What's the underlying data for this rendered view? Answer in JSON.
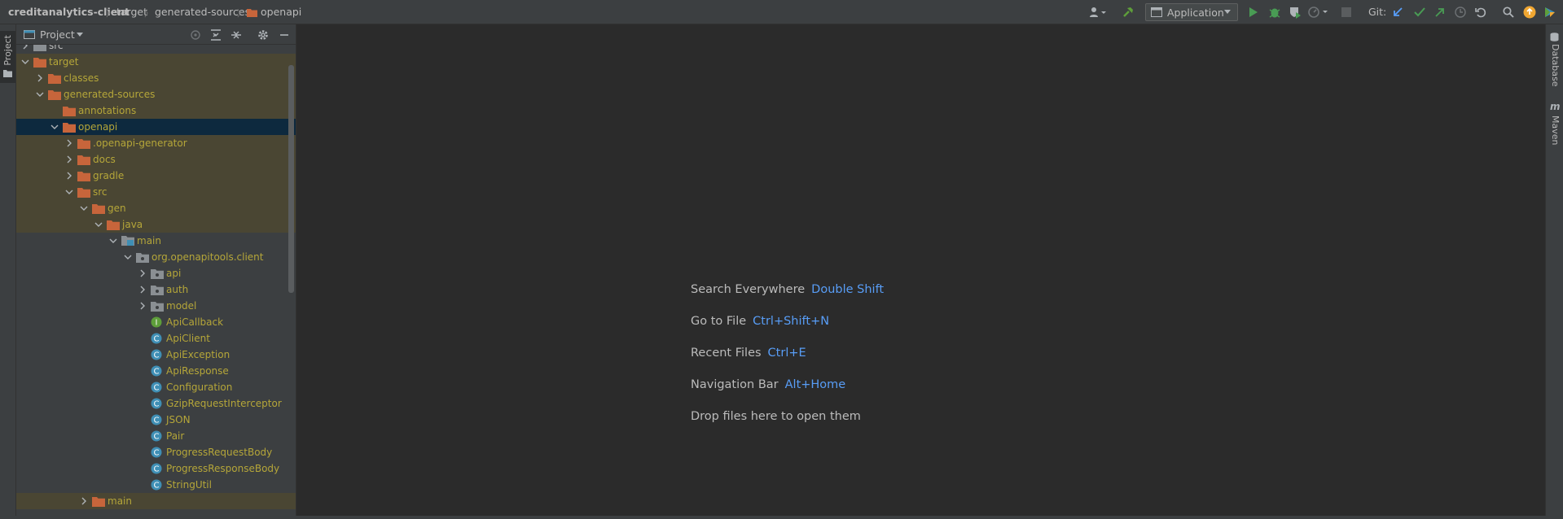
{
  "breadcrumb": [
    "creditanalytics-client",
    "target",
    "generated-sources",
    "openapi"
  ],
  "toolbar": {
    "run_config": "Application",
    "git_label": "Git:"
  },
  "left_strip": {
    "project_tab": "Project"
  },
  "right_strip": {
    "database_tab": "Database",
    "maven_tab": "Maven"
  },
  "project_panel": {
    "view_selector": "Project"
  },
  "tree": [
    {
      "label": "src",
      "depth": 1,
      "expanded": false,
      "type": "folder-gray",
      "style": "plain"
    },
    {
      "label": "target",
      "depth": 1,
      "expanded": true,
      "type": "folder-orange",
      "style": "excluded"
    },
    {
      "label": "classes",
      "depth": 2,
      "expanded": false,
      "type": "folder-orange",
      "style": "excluded"
    },
    {
      "label": "generated-sources",
      "depth": 2,
      "expanded": true,
      "type": "folder-orange",
      "style": "excluded"
    },
    {
      "label": "annotations",
      "depth": 3,
      "expanded": null,
      "type": "folder-orange",
      "style": "excluded"
    },
    {
      "label": "openapi",
      "depth": 3,
      "expanded": true,
      "type": "folder-orange",
      "style": "selected"
    },
    {
      "label": ".openapi-generator",
      "depth": 4,
      "expanded": false,
      "type": "folder-orange",
      "style": "excluded"
    },
    {
      "label": "docs",
      "depth": 4,
      "expanded": false,
      "type": "folder-orange",
      "style": "excluded"
    },
    {
      "label": "gradle",
      "depth": 4,
      "expanded": false,
      "type": "folder-orange",
      "style": "excluded"
    },
    {
      "label": "src",
      "depth": 4,
      "expanded": true,
      "type": "folder-orange",
      "style": "excluded"
    },
    {
      "label": "gen",
      "depth": 5,
      "expanded": true,
      "type": "folder-orange",
      "style": "excluded"
    },
    {
      "label": "java",
      "depth": 6,
      "expanded": true,
      "type": "folder-orange",
      "style": "excluded"
    },
    {
      "label": "main",
      "depth": 7,
      "expanded": true,
      "type": "folder-module",
      "style": "plainOlive"
    },
    {
      "label": "org.openapitools.client",
      "depth": 8,
      "expanded": true,
      "type": "package",
      "style": "plainOlive"
    },
    {
      "label": "api",
      "depth": 9,
      "expanded": false,
      "type": "package",
      "style": "plainOlive"
    },
    {
      "label": "auth",
      "depth": 9,
      "expanded": false,
      "type": "package",
      "style": "plainOlive"
    },
    {
      "label": "model",
      "depth": 9,
      "expanded": false,
      "type": "package",
      "style": "plainOlive"
    },
    {
      "label": "ApiCallback",
      "depth": 9,
      "expanded": null,
      "type": "interface",
      "style": "plainOlive"
    },
    {
      "label": "ApiClient",
      "depth": 9,
      "expanded": null,
      "type": "class",
      "style": "plainOlive"
    },
    {
      "label": "ApiException",
      "depth": 9,
      "expanded": null,
      "type": "class",
      "style": "plainOlive"
    },
    {
      "label": "ApiResponse",
      "depth": 9,
      "expanded": null,
      "type": "class",
      "style": "plainOlive"
    },
    {
      "label": "Configuration",
      "depth": 9,
      "expanded": null,
      "type": "class",
      "style": "plainOlive"
    },
    {
      "label": "GzipRequestInterceptor",
      "depth": 9,
      "expanded": null,
      "type": "class",
      "style": "plainOlive"
    },
    {
      "label": "JSON",
      "depth": 9,
      "expanded": null,
      "type": "class",
      "style": "plainOlive"
    },
    {
      "label": "Pair",
      "depth": 9,
      "expanded": null,
      "type": "class",
      "style": "plainOlive"
    },
    {
      "label": "ProgressRequestBody",
      "depth": 9,
      "expanded": null,
      "type": "class",
      "style": "plainOlive"
    },
    {
      "label": "ProgressResponseBody",
      "depth": 9,
      "expanded": null,
      "type": "class",
      "style": "plainOlive"
    },
    {
      "label": "StringUtil",
      "depth": 9,
      "expanded": null,
      "type": "class",
      "style": "plainOlive"
    },
    {
      "label": "main",
      "depth": 5,
      "expanded": false,
      "type": "folder-orange",
      "style": "excluded"
    }
  ],
  "editor": {
    "hints": [
      {
        "label": "Search Everywhere",
        "shortcut": "Double Shift"
      },
      {
        "label": "Go to File",
        "shortcut": "Ctrl+Shift+N"
      },
      {
        "label": "Recent Files",
        "shortcut": "Ctrl+E"
      },
      {
        "label": "Navigation Bar",
        "shortcut": "Alt+Home"
      },
      {
        "label": "Drop files here to open them",
        "shortcut": ""
      }
    ]
  },
  "colors": {
    "folder_orange": "#c7653b",
    "folder_gray": "#8a8f93",
    "class_icon": "#3f8fb5",
    "interface_icon": "#5e9e3a",
    "excluded_bg": "#4a4633",
    "selected_bg": "#0d293e",
    "olive_text": "#b5a639",
    "shortcut_blue": "#589df6"
  }
}
